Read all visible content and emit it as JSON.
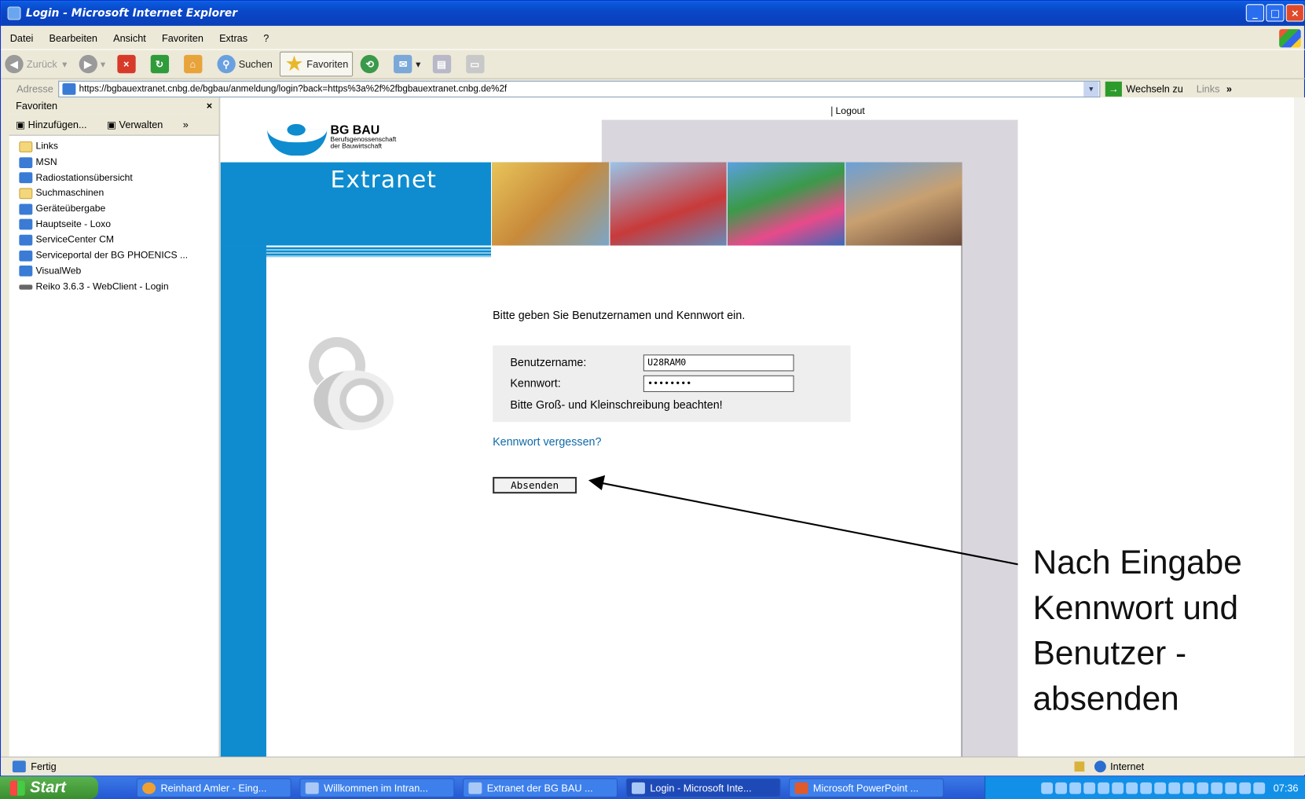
{
  "window": {
    "title": "Login - Microsoft Internet Explorer"
  },
  "menu": [
    "Datei",
    "Bearbeiten",
    "Ansicht",
    "Favoriten",
    "Extras",
    "?"
  ],
  "toolbar": {
    "back": "Zurück",
    "search": "Suchen",
    "favorites": "Favoriten"
  },
  "address": {
    "label": "Adresse",
    "url": "https://bgbauextranet.cnbg.de/bgbau/anmeldung/login?back=https%3a%2f%2fbgbauextranet.cnbg.de%2f",
    "go": "Wechseln zu",
    "links": "Links"
  },
  "favorites": {
    "title": "Favoriten",
    "add": "Hinzufügen...",
    "manage": "Verwalten",
    "items": [
      "Links",
      "MSN",
      "Radiostationsübersicht",
      "Suchmaschinen",
      "Geräteübergabe",
      "Hauptseite - Loxo",
      "ServiceCenter CM",
      "Serviceportal der BG PHOENICS ...",
      "VisualWeb",
      "Reiko 3.6.3 - WebClient - Login"
    ]
  },
  "page": {
    "logout": "Logout",
    "logo_name": "BG BAU",
    "logo_line1": "Berufsgenossenschaft",
    "logo_line2": "der Bauwirtschaft",
    "extranet": "Extranet",
    "prompt": "Bitte geben Sie Benutzernamen und Kennwort ein.",
    "username_label": "Benutzername:",
    "username_value": "U28RAM0",
    "password_label": "Kennwort:",
    "password_value": "••••••••",
    "hint": "Bitte Groß- und Kleinschreibung beachten!",
    "forgot": "Kennwort vergessen?",
    "submit": "Absenden"
  },
  "annotation": {
    "line1": "Nach Eingabe",
    "line2": "Kennwort und",
    "line3": "Benutzer -",
    "line4": "absenden"
  },
  "status": {
    "text": "Fertig",
    "zone": "Internet"
  },
  "taskbar": {
    "start": "Start",
    "tasks": [
      "Reinhard Amler - Eing...",
      "Willkommen im Intran...",
      "Extranet der BG BAU ...",
      "Login - Microsoft Inte...",
      "Microsoft PowerPoint ..."
    ],
    "clock": "07:36"
  },
  "colors": {
    "brand_blue": "#0e8ccf",
    "link": "#0e6aa8",
    "taskbar": "#2456d4"
  }
}
